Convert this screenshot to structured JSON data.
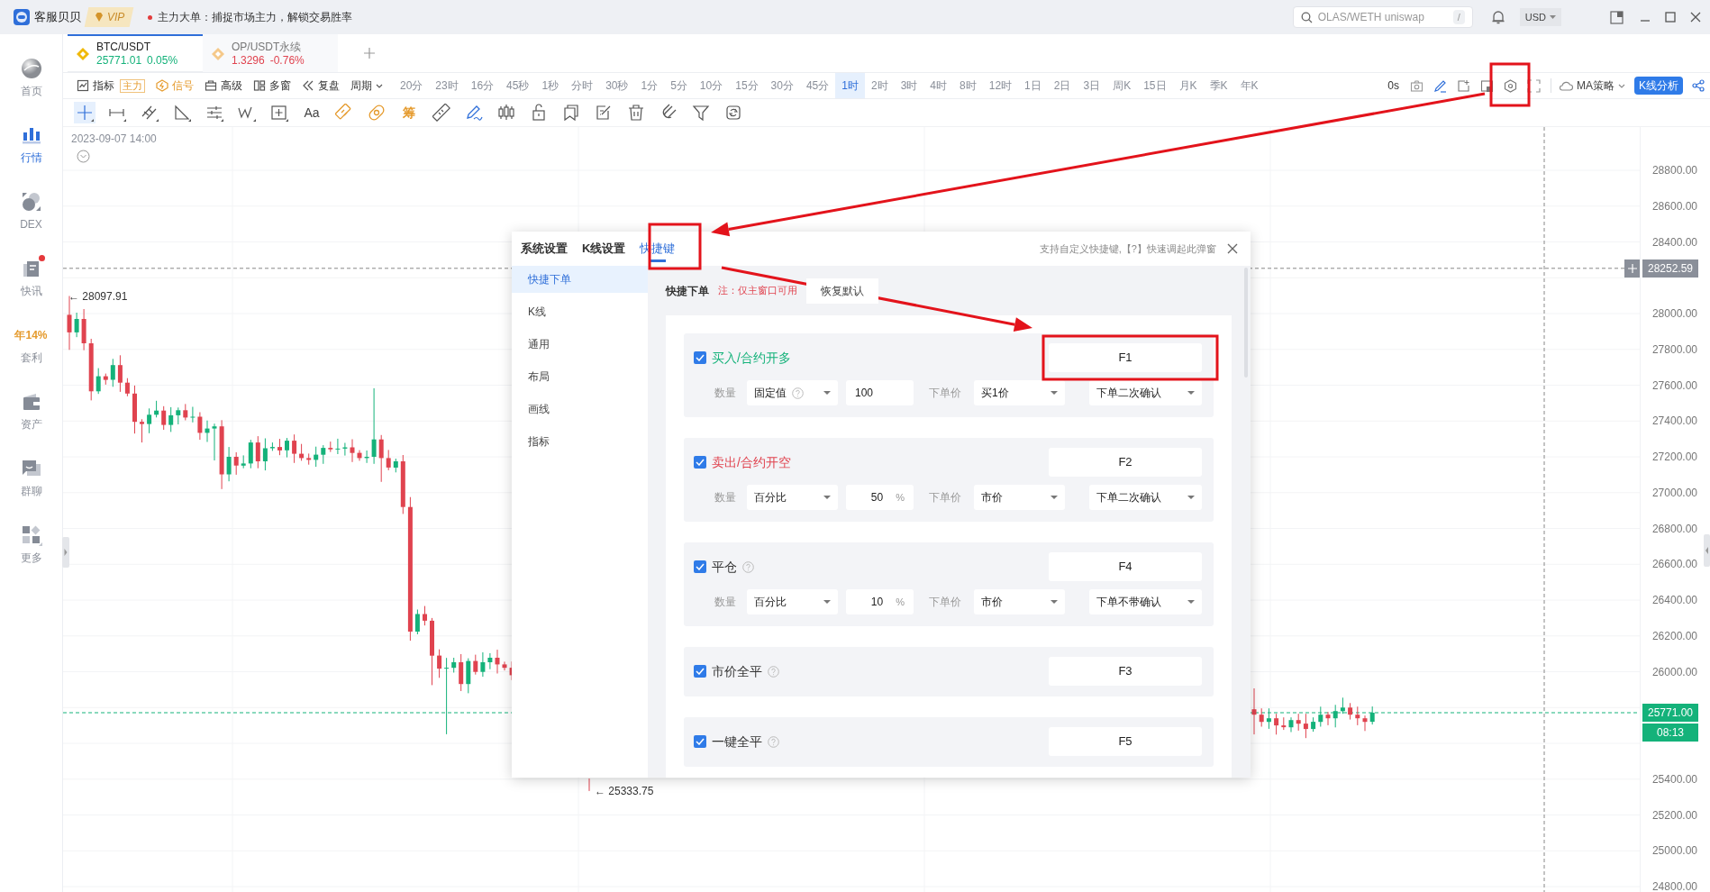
{
  "topbar": {
    "app_name": "客服贝贝",
    "vip": "VIP",
    "notice": "主力大单：捕捉市场主力，解锁交易胜率",
    "search": {
      "placeholder": "OLAS/WETH uniswap",
      "shortcut": "/"
    },
    "currency": "USD"
  },
  "sidebar": {
    "items": [
      {
        "kind": "globe",
        "label": "首页",
        "selected": false,
        "notification": false
      },
      {
        "kind": "bars",
        "label": "行情",
        "selected": true,
        "notification": false
      },
      {
        "kind": "dex",
        "label": "DEX",
        "selected": false,
        "notification": false
      },
      {
        "kind": "news",
        "label": "快讯",
        "selected": false,
        "notification": true
      },
      {
        "kind": "promo",
        "badge": "年14%",
        "label": "套利",
        "selected": false,
        "notification": false
      },
      {
        "kind": "wallet",
        "label": "资产",
        "selected": false,
        "notification": false
      },
      {
        "kind": "chat",
        "label": "群聊",
        "selected": false,
        "notification": false
      },
      {
        "kind": "more",
        "label": "更多",
        "selected": false,
        "notification": false
      }
    ]
  },
  "symbol_tabs": [
    {
      "symbol": "BTC/USDT",
      "price": "25771.01",
      "change": "0.05%",
      "color": "#14b27a",
      "selected": true
    },
    {
      "symbol": "OP/USDT永续",
      "price": "1.3296",
      "change": "-0.76%",
      "color": "#e0434f",
      "selected": false
    }
  ],
  "toolbar": {
    "tools": [
      {
        "kind": "indicator",
        "label": "指标",
        "badge": "主力"
      },
      {
        "kind": "signal",
        "label": "信号"
      },
      {
        "kind": "advanced",
        "label": "高级"
      },
      {
        "kind": "multi",
        "label": "多窗"
      },
      {
        "kind": "replay",
        "label": "复盘"
      },
      {
        "kind": "period",
        "label": "周期"
      }
    ],
    "intervals": [
      {
        "label": "20分",
        "selected": false
      },
      {
        "label": "23时",
        "selected": false
      },
      {
        "label": "16分",
        "selected": false
      },
      {
        "label": "45秒",
        "selected": false
      },
      {
        "label": "1秒",
        "selected": false
      },
      {
        "label": "分时",
        "selected": false
      },
      {
        "label": "30秒",
        "selected": false
      },
      {
        "label": "1分",
        "selected": false
      },
      {
        "label": "5分",
        "selected": false
      },
      {
        "label": "10分",
        "selected": false
      },
      {
        "label": "15分",
        "selected": false
      },
      {
        "label": "30分",
        "selected": false
      },
      {
        "label": "45分",
        "selected": false
      },
      {
        "label": "1时",
        "selected": true
      },
      {
        "label": "2时",
        "selected": false
      },
      {
        "label": "3时",
        "selected": false
      },
      {
        "label": "4时",
        "selected": false
      },
      {
        "label": "8时",
        "selected": false
      },
      {
        "label": "12时",
        "selected": false
      },
      {
        "label": "1日",
        "selected": false
      },
      {
        "label": "2日",
        "selected": false
      },
      {
        "label": "3日",
        "selected": false
      },
      {
        "label": "周K",
        "selected": false
      },
      {
        "label": "15日",
        "selected": false
      },
      {
        "label": "月K",
        "selected": false
      },
      {
        "label": "季K",
        "selected": false
      },
      {
        "label": "年K",
        "selected": false
      }
    ],
    "countdown": "0s",
    "strategy": "MA策略",
    "analysis_button": "K线分析"
  },
  "drawing_tools": [
    {
      "kind": "crosshair",
      "selected": true
    },
    {
      "kind": "segment",
      "selected": false
    },
    {
      "kind": "parallel",
      "selected": false
    },
    {
      "kind": "angle",
      "selected": false
    },
    {
      "kind": "hlines",
      "selected": false
    },
    {
      "kind": "wave",
      "selected": false
    },
    {
      "kind": "box",
      "selected": false
    },
    {
      "kind": "text",
      "label": "Aa",
      "selected": false
    },
    {
      "kind": "tag",
      "selected": false
    },
    {
      "kind": "bandage",
      "selected": false
    },
    {
      "kind": "chip",
      "label": "筹",
      "selected": false
    },
    {
      "kind": "ruler",
      "selected": false
    },
    {
      "kind": "pen",
      "selected": false
    },
    {
      "kind": "candles",
      "selected": false
    },
    {
      "kind": "lock",
      "selected": false
    },
    {
      "kind": "bookmark",
      "selected": false
    },
    {
      "kind": "edit",
      "selected": false
    },
    {
      "kind": "trash",
      "selected": false
    },
    {
      "kind": "magnet",
      "selected": false
    },
    {
      "kind": "filter",
      "selected": false
    },
    {
      "kind": "sync",
      "selected": false
    }
  ],
  "chart": {
    "timestamp": "2023-09-07 14:00",
    "high_marker": "← 28097.91",
    "low_marker": "← 25333.75",
    "price_axis_upper": [
      "28800.00",
      "28600.00",
      "28400.00"
    ],
    "price_axis_middle": [
      "28000.00",
      "27800.00",
      "27600.00",
      "27400.00",
      "27200.00",
      "27000.00",
      "26800.00",
      "26600.00",
      "26400.00",
      "26200.00",
      "26000.00"
    ],
    "price_axis_lower": [
      "25400.00",
      "25200.00",
      "25000.00",
      "24800.00"
    ],
    "crosshair_price": "28252.59",
    "last_price": "25771.00",
    "countdown": "08:13"
  },
  "dialog": {
    "tabs": [
      {
        "label": "系统设置",
        "selected": false
      },
      {
        "label": "K线设置",
        "selected": false
      },
      {
        "label": "快捷键",
        "selected": true
      }
    ],
    "hint": "支持自定义快捷键,【?】快速调起此弹窗",
    "nav": [
      {
        "label": "快捷下单",
        "selected": true
      },
      {
        "label": "K线",
        "selected": false
      },
      {
        "label": "通用",
        "selected": false
      },
      {
        "label": "布局",
        "selected": false
      },
      {
        "label": "画线",
        "selected": false
      },
      {
        "label": "指标",
        "selected": false
      }
    ],
    "section_title": "快捷下单",
    "note": "注：仅主窗口可用",
    "reset_button": "恢复默认",
    "shortcuts": [
      {
        "label": "买入/合约开多",
        "color": "#14b27a",
        "checked": true,
        "help": false,
        "key": "F1",
        "order": {
          "quantity_label": "数量",
          "quantity_mode": "固定值",
          "mode_help": true,
          "quantity": "100",
          "price_label": "下单价",
          "price_type": "买1价",
          "confirm": "下单二次确认"
        }
      },
      {
        "label": "卖出/合约开空",
        "color": "#e0434f",
        "checked": true,
        "help": false,
        "key": "F2",
        "order": {
          "quantity_label": "数量",
          "quantity_mode": "百分比",
          "mode_help": false,
          "quantity": "50",
          "unit": "%",
          "price_label": "下单价",
          "price_type": "市价",
          "confirm": "下单二次确认"
        }
      },
      {
        "label": "平仓",
        "color": "#333333",
        "checked": true,
        "help": true,
        "key": "F4",
        "order": {
          "quantity_label": "数量",
          "quantity_mode": "百分比",
          "mode_help": false,
          "quantity": "10",
          "unit": "%",
          "price_label": "下单价",
          "price_type": "市价",
          "confirm": "下单不带确认"
        }
      },
      {
        "label": "市价全平",
        "color": "#333333",
        "checked": true,
        "help": true,
        "key": "F3"
      },
      {
        "label": "一键全平",
        "color": "#333333",
        "checked": true,
        "help": true,
        "key": "F5"
      }
    ]
  }
}
